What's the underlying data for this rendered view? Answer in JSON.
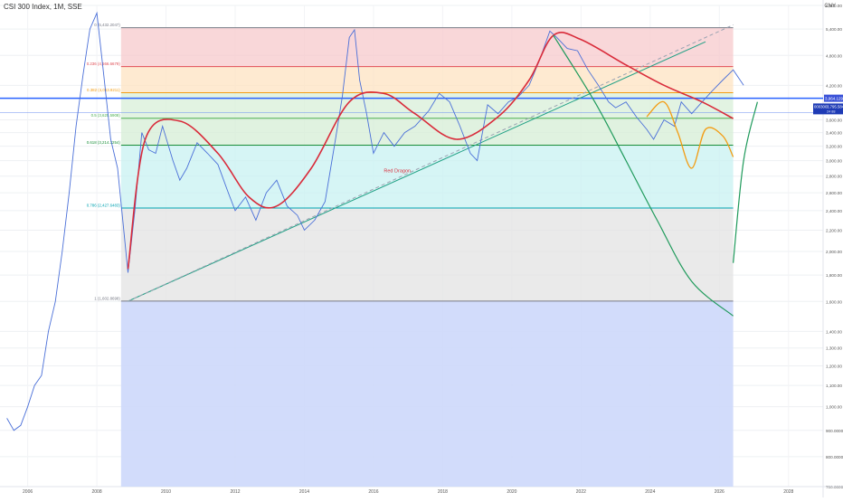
{
  "header": {
    "symbol_line": "CSI 300 Index, 1M, SSE",
    "currency": "CNY"
  },
  "colors": {
    "line": "#4a6fd8",
    "red_curve": "#d92b3a",
    "green_curve": "#1f9a5b",
    "orange_curve": "#f39c12",
    "trend": "#21a085",
    "price_badge": "#3a52d8",
    "price_badge_dark": "#1e3bb5"
  },
  "chart_data": {
    "type": "line",
    "title": "CSI 300 Index, 1M, SSE",
    "y_scale": "log",
    "ylim": [
      700,
      6000
    ],
    "xlim": [
      2005.2,
      2029
    ],
    "grid": true,
    "x_ticks": [
      "2006",
      "2008",
      "2010",
      "2012",
      "2014",
      "2016",
      "2018",
      "2020",
      "2022",
      "2024",
      "2026",
      "2028"
    ],
    "y_ticks": [
      "6,000.00",
      "5,400.00",
      "4,800.00",
      "4,200.00",
      "3,600.00",
      "3,400.00",
      "3,200.00",
      "3,000.00",
      "2,800.00",
      "2,600.00",
      "2,400.00",
      "2,200.00",
      "2,000.00",
      "1,800.00",
      "1,600.00",
      "1,400.00",
      "1,300.00",
      "1,200.00",
      "1,100.00",
      "1,000.00",
      "900.0000",
      "800.0000",
      "700.0000"
    ],
    "series": [
      {
        "name": "",
        "x": [
          2005.4,
          2005.6,
          2005.8,
          2006.0,
          2006.2,
          2006.4,
          2006.6,
          2006.8,
          2007.0,
          2007.2,
          2007.4,
          2007.6,
          2007.8,
          2008.0,
          2008.2,
          2008.4,
          2008.6,
          2008.9,
          2009.1,
          2009.3,
          2009.5,
          2009.7,
          2009.9,
          2010.2,
          2010.4,
          2010.6,
          2010.9,
          2011.2,
          2011.5,
          2011.8,
          2012.0,
          2012.3,
          2012.6,
          2012.9,
          2013.2,
          2013.5,
          2013.8,
          2014.0,
          2014.3,
          2014.6,
          2014.9,
          2015.1,
          2015.3,
          2015.45,
          2015.6,
          2015.8,
          2016.0,
          2016.3,
          2016.6,
          2016.9,
          2017.2,
          2017.6,
          2017.9,
          2018.2,
          2018.5,
          2018.8,
          2019.0,
          2019.3,
          2019.6,
          2019.9,
          2020.2,
          2020.5,
          2020.8,
          2021.1,
          2021.3,
          2021.6,
          2021.9,
          2022.2,
          2022.5,
          2022.8,
          2023.0,
          2023.3,
          2023.6,
          2023.9,
          2024.1,
          2024.4,
          2024.7,
          2024.9,
          2025.2,
          2025.5,
          2025.8,
          2026.1,
          2026.4,
          2026.7
        ],
        "y": [
          950,
          900,
          920,
          1000,
          1100,
          1150,
          1400,
          1600,
          2000,
          2600,
          3500,
          4400,
          5400,
          5800,
          4400,
          3300,
          2900,
          1820,
          2400,
          3400,
          3150,
          3100,
          3500,
          3000,
          2750,
          2900,
          3250,
          3100,
          2950,
          2600,
          2400,
          2550,
          2300,
          2600,
          2750,
          2450,
          2350,
          2200,
          2300,
          2500,
          3300,
          4000,
          5200,
          5380,
          4300,
          3700,
          3100,
          3400,
          3200,
          3400,
          3500,
          3750,
          4050,
          3900,
          3500,
          3100,
          3000,
          3850,
          3700,
          3900,
          4000,
          4200,
          4700,
          5350,
          5200,
          4950,
          4900,
          4500,
          4200,
          3900,
          3800,
          3900,
          3650,
          3450,
          3300,
          3600,
          3500,
          3900,
          3700,
          3900,
          4100,
          4300,
          4500,
          4200
        ]
      }
    ],
    "fib_levels": [
      {
        "label": "0 (5,432.2047)",
        "value": 5432.2047
      },
      {
        "label": "0.236 (4,566.6679)",
        "value": 4566.6679
      },
      {
        "label": "0.382 (4,063.9211)",
        "value": 4063.9211
      },
      {
        "label": "0.5 (3,625.5908)",
        "value": 3625.5908
      },
      {
        "label": "0.618 (3,214.3254)",
        "value": 3214.3254
      },
      {
        "label": "0.786 (2,427.6483)",
        "value": 2427.6483
      },
      {
        "label": "1 (1,602.8698)",
        "value": 1602.8698
      }
    ],
    "annotations": [
      {
        "text": "Red Dragon"
      }
    ],
    "price_labels": [
      {
        "text": "3,964.1291"
      },
      {
        "text": "000300",
        "sub": "24 88",
        "value_text": "3,795.5849"
      }
    ]
  }
}
